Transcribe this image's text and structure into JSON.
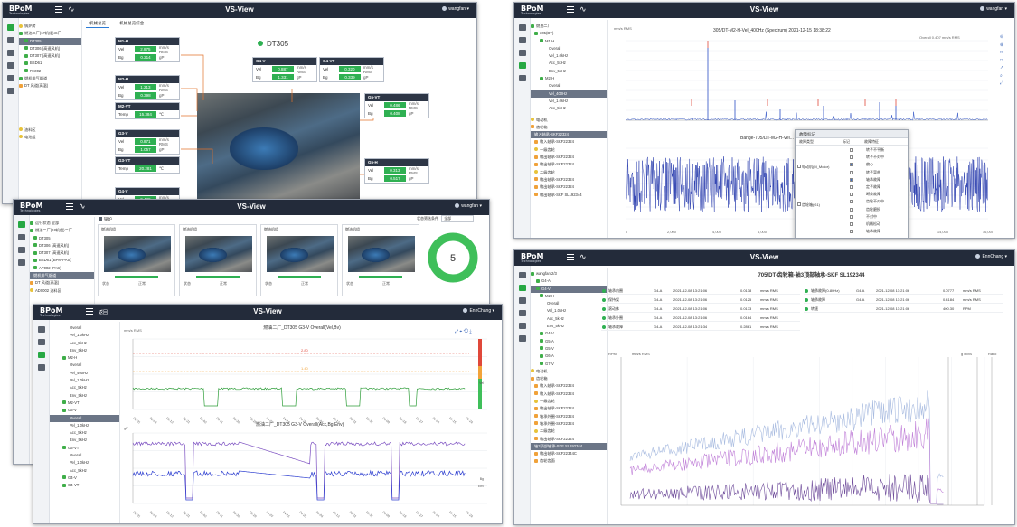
{
  "brand": {
    "logo": "BPoM",
    "logo_sub": "Technologies"
  },
  "app_title": "VS-View",
  "windows": {
    "w1": {
      "user": "wangfan ▾",
      "tabs": [
        "机械总览",
        "机械总览综合"
      ],
      "tree": [
        "锅炉房",
        "燃油二厂(1#机组)二厂",
        "DT305",
        "DT306 (高速风机)",
        "DT307 (高速风机)",
        "BSD61",
        "PA002",
        "燃机排气烟道",
        "DT 风道(高温)",
        "油料区",
        "电池组"
      ],
      "machine_title": "DT305",
      "sensors": [
        {
          "name": "M1-H",
          "r1": "Vel",
          "v1": "2.875",
          "u1": "mm/s RMS",
          "r2": "Bg",
          "v2": "0.214",
          "u2": "gP"
        },
        {
          "name": "M2-H",
          "r1": "Vel",
          "v1": "1.213",
          "u1": "mm/s RMS",
          "r2": "Bg",
          "v2": "0.398",
          "u2": "gP"
        },
        {
          "name": "M2-VT",
          "r1": "Temp",
          "v1": "15.384",
          "u1": "℃",
          "r2": "",
          "v2": "",
          "u2": ""
        },
        {
          "name": "G3-V",
          "r1": "Vel",
          "v1": "0.871",
          "u1": "mm/s RMS",
          "r2": "Bg",
          "v2": "1.057",
          "u2": "gP"
        },
        {
          "name": "G3-VT",
          "r1": "Temp",
          "v1": "20.281",
          "u1": "℃",
          "r2": "",
          "v2": "",
          "u2": ""
        },
        {
          "name": "G4-V",
          "r1": "Vel",
          "v1": "0.438",
          "u1": "mm/s RMS",
          "r2": "",
          "v2": "",
          "u2": ""
        },
        {
          "name": "G4-V",
          "r1": "Vel",
          "v1": "0.887",
          "u1": "mm/s RMS",
          "r2": "Bg",
          "v2": "1.331",
          "u2": "gP"
        },
        {
          "name": "G4-VT",
          "r1": "Vel",
          "v1": "0.320",
          "u1": "mm/s RMS",
          "r2": "Bg",
          "v2": "0.339",
          "u2": "gP"
        },
        {
          "name": "G5-VT",
          "r1": "Vel",
          "v1": "0.486",
          "u1": "mm/s RMS",
          "r2": "Bg",
          "v2": "0.408",
          "u2": "gP"
        },
        {
          "name": "G5-H",
          "r1": "Vel",
          "v1": "0.313",
          "u1": "mm/s RMS",
          "r2": "Bg",
          "v2": "0.517",
          "u2": "gP"
        }
      ]
    },
    "w2": {
      "user": "wangfan ▾",
      "breadcrumb": "锅炉",
      "filter_label": "状态筛选条件",
      "filter_value": "全部",
      "tree": [
        "运行状态 全部",
        "燃油二厂(1#机组)二厂",
        "DT305",
        "DT306 (高速风机)",
        "DT307 (高速风机)",
        "BSD61 (BPM-PAS)",
        "AP002 (PAS)",
        "燃机排气烟道",
        "DT 风道(高温)",
        "AD0002 油料区"
      ],
      "cards": [
        {
          "title": "燃油机组",
          "a": "状态",
          "b": "正常"
        },
        {
          "title": "燃油机组",
          "a": "状态",
          "b": "正常"
        },
        {
          "title": "燃油机组",
          "a": "状态",
          "b": "正常"
        },
        {
          "title": "燃油机组",
          "a": "状态",
          "b": "正常"
        }
      ],
      "donut_value": "5"
    },
    "w3": {
      "user": "EnnChang ▾",
      "back_label": "返回",
      "tree": [
        "Overall",
        "Vel_1.0kHz",
        "Acc_5kHz",
        "Env_5kHz",
        "M2-H",
        "Overall",
        "Vel_400Hz",
        "Vel_1.0kHz",
        "Acc_5kHz",
        "Env_5kHz",
        "M2-VT",
        "G3-V",
        "Overall",
        "Vel_1.0kHz",
        "Acc_5kHz",
        "Env_5kHz",
        "G3-VT",
        "Overall",
        "Vel_1.0kHz",
        "Acc_5kHz",
        "G4-V",
        "G4-VT"
      ],
      "chart1_title": "燃油二厂_DT305 G3-V Overall(Vel,Bv)",
      "chart1_unit": "mm/s RMS",
      "chart1_alarm": "2.80",
      "chart1_warn": "1.40",
      "chart2_title": "燃油二厂_DT305 G3-V Overall(Acc,Bg,Env)",
      "chart2_unit": "gP",
      "legend1": [
        "Vel"
      ],
      "legend2": [
        "Bg",
        "Env"
      ],
      "x_labels": [
        "01-25",
        "02-03",
        "02-12",
        "02-21",
        "03-02",
        "03-11",
        "03-20",
        "03-29",
        "04-07",
        "04-16",
        "04-25",
        "05-04",
        "05-13",
        "05-22",
        "05-31",
        "06-09",
        "06-18",
        "06-27",
        "07-06",
        "07-15",
        "07-24"
      ]
    },
    "w4": {
      "user": "wangfan ▾",
      "tree_root": "燃油二厂",
      "tree": [
        "305(DT)",
        "M1-H",
        "Overall",
        "Vel_1.0kHz",
        "Acc_5kHz",
        "Env_5kHz",
        "M2-H",
        "Overall",
        "Vel_400Hz",
        "Vel_1.0kHz",
        "Acc_5kHz",
        "电动机",
        "齿轮箱",
        "输入轴承-SKF22324",
        "输入轴承-SKF22324",
        "一级齿轮",
        "输出轴承-SKF22324",
        "输出轴承-SKF22324",
        "二级齿轮",
        "输出轴承-SKF22324",
        "输出轴承-SKF22324",
        "输出轴承-SKF SL192344"
      ],
      "chart_title": "305/DT-M2-H-Vel_400Hz (Spectrum) 2021-12-15 18:38:22",
      "chart_unit": "mm/s RMS",
      "overall_label": "Overall",
      "overall_val": "0.407 mm/s RMS",
      "wave_title": "Bange-705/DT-M2-H-Vel...",
      "x_ticks": [
        "0",
        "2,000",
        "4,000",
        "6,000",
        "8,000",
        "10,000",
        "12,000",
        "14,000",
        "16,000"
      ],
      "dialog_title": "故障标记",
      "dialog_headers": [
        "故障类型",
        "标记",
        "故障特征"
      ],
      "dialog_groups": [
        "电动机(M_Motor)",
        "齿轮箱(G1)"
      ],
      "dialog_rows": [
        "转子不平衡",
        "转子不对中",
        "偏心",
        "转子弯曲",
        "轴承故障",
        "定子故障",
        "断条故障",
        "齿轮不对中",
        "齿轮磨损",
        "不对中",
        "机械松动",
        "轴承故障"
      ]
    },
    "w5": {
      "user": "EnnChang ▾",
      "tree_root": "wangfan 2/3",
      "chart_title": "705/DT-齿轮箱-轴3顶部轴承-SKF SL192344",
      "table": [
        {
          "name": "轴承内圈",
          "sensor": "G4-A",
          "time": "2021-12-08 13:21:06",
          "val": "0.0138",
          "unit": "mm/s RMS"
        },
        {
          "name": "保持架",
          "sensor": "G4-A",
          "time": "2021-12-08 13:21:06",
          "val": "0.0125",
          "unit": "mm/s RMS"
        },
        {
          "name": "滚动体",
          "sensor": "G4-A",
          "time": "2021-12-08 13:21:06",
          "val": "0.0173",
          "unit": "mm/s RMS"
        },
        {
          "name": "轴承外圈",
          "sensor": "G4-A",
          "time": "2021-12-08 13:21:06",
          "val": "0.0164",
          "unit": "mm/s RMS"
        },
        {
          "name": "轴承故障",
          "sensor": "G4-A",
          "time": "2021-12-08 13:21:34",
          "val": "0.2861",
          "unit": "mm/s RMS"
        },
        {
          "name": "轴承故障(0-80Hz)",
          "sensor": "G4-A",
          "time": "2021-12-08 13:21:06",
          "val": "0.0777",
          "unit": "mm/s RMS"
        },
        {
          "name": "轴承故障",
          "sensor": "G4-A",
          "time": "2021-12-08 13:21:06",
          "val": "0.4184",
          "unit": "mm/s RMS"
        },
        {
          "name": "转速",
          "sensor": "",
          "time": "2021-12-08 13:21:06",
          "val": "400.30",
          "unit": "RPM"
        }
      ],
      "axis_labels": [
        "RPM",
        "mm/s RMS",
        "g RMS",
        "Ratio"
      ],
      "tree": [
        "G4-A",
        "G4-V",
        "M2-H",
        "Overall",
        "Vel_1.0kHz",
        "Acc_5kHz",
        "Env_5kHz",
        "G4-V",
        "G5-A",
        "G5-V",
        "G6-A",
        "G7-V",
        "电动机",
        "齿轮箱",
        "输入轴承-SKF22324",
        "输入轴承-SKF22324",
        "一级齿轮",
        "输出轴承-SKF22324",
        "轴承外圈-SKF22324",
        "轴承外圈-SKF22324",
        "二级齿轮",
        "输出轴承-SKF22324",
        "轴3顶部轴承-SKF SL192344",
        "输出轴承-SKF22344C",
        "齿轮齿面"
      ]
    }
  }
}
